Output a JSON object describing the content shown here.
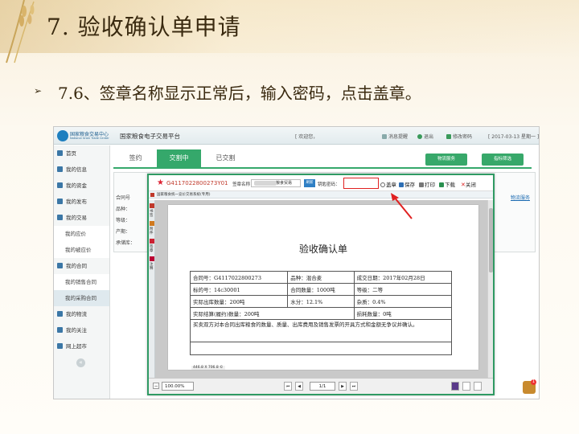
{
  "slide": {
    "title": "7. 验收确认单申请",
    "bullet": "7.6、签章名称显示正常后，输入密码，点击盖章。"
  },
  "app": {
    "logo_name": "国家粮食交易中心",
    "logo_sub": "National Grain Trade Center",
    "platform": "国家粮食电子交易平台",
    "welcome": "[ 欢迎您，",
    "messages": "消息提醒",
    "logout": "退出",
    "change_password": "修改密码",
    "date": "[ 2017-03-13 星期一 ]"
  },
  "sidebar": {
    "items": [
      {
        "label": "首页",
        "sub": false
      },
      {
        "label": "我的信息",
        "sub": false
      },
      {
        "label": "我的资金",
        "sub": false
      },
      {
        "label": "我的发布",
        "sub": false
      },
      {
        "label": "我的交易",
        "sub": false
      },
      {
        "label": "我的应价",
        "sub": true
      },
      {
        "label": "我的被应价",
        "sub": true
      },
      {
        "label": "我的合同",
        "sub": false
      },
      {
        "label": "我的销售合同",
        "sub": true
      },
      {
        "label": "我的采购合同",
        "sub": true
      },
      {
        "label": "我的物流",
        "sub": false
      },
      {
        "label": "我的关注",
        "sub": false
      },
      {
        "label": "网上超市",
        "sub": false
      }
    ],
    "collapse": "«"
  },
  "tabs": [
    {
      "label": "签约",
      "active": false
    },
    {
      "label": "交割中",
      "active": true
    },
    {
      "label": "已交割",
      "active": false
    }
  ],
  "green_buttons": [
    "物流服务",
    "指标筛选"
  ],
  "background": {
    "contract_label": "合同号",
    "variety_label": "品种：",
    "grade_label": "等级：",
    "origin_label": "产期：",
    "trader_label": "承储库：",
    "link": "物流服务"
  },
  "dialog": {
    "contract_id": "G4117022800273Y01",
    "sig_label": "签章名称：",
    "sig_value": "粮食贸易",
    "refresh": "刷新",
    "pwd_label": "钥匙密码：",
    "tools": {
      "stamp": "盖章",
      "save": "保存",
      "print": "打印",
      "download": "下载",
      "close": "关闭"
    },
    "pdf_header": "国家粮食统一竞价交易系统(专用)",
    "side_tabs": [
      "书签",
      "附件",
      "签章",
      "注释"
    ],
    "page_size": "446.8 X 706.8 ©",
    "zoom": "100.00%",
    "page_indicator": "1/1"
  },
  "document": {
    "title": "验收确认单",
    "rows": [
      [
        "合同号：G4117022800273",
        "品种：混合麦",
        "成交日期：2017年02月28日"
      ],
      [
        "标的号：14c30001",
        "合同数量：1000吨",
        "等级：二等"
      ],
      [
        "实际出库数量：200吨",
        "水分：12.1%",
        "杂质：0.4%"
      ],
      [
        "实际结算(履约)数量：200吨",
        "",
        "损耗数量：0吨"
      ]
    ],
    "note": "买卖双方对本合同出库粮食的数量、质量、出库费用及销售发票的开具方式和金额无争议并确认。"
  },
  "colors": {
    "accent_green": "#35a86b",
    "highlight_red": "#e02020",
    "brand_blue": "#1e7fbf"
  }
}
